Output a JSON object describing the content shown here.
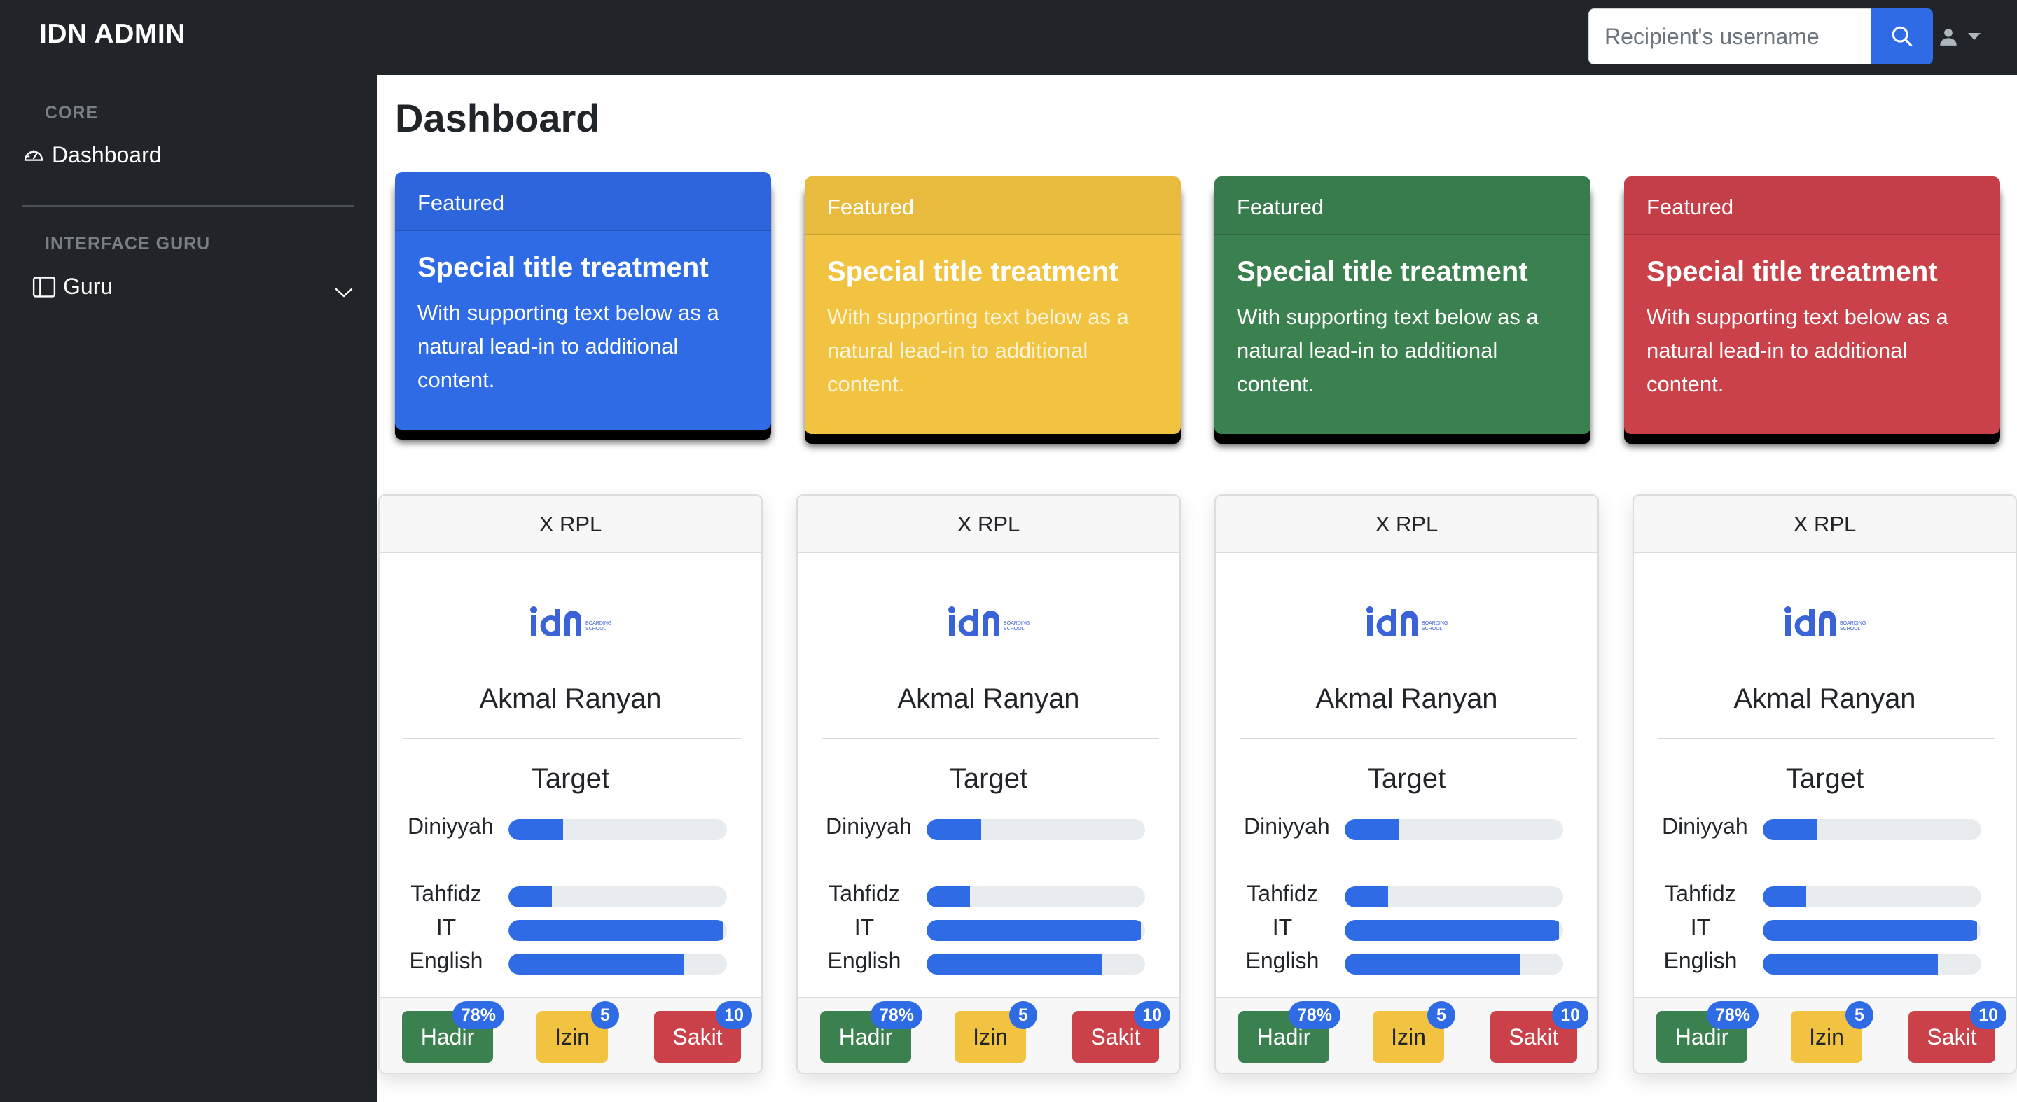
{
  "brand": "IDN ADMIN",
  "search": {
    "placeholder": "Recipient's username",
    "icon": "search-icon"
  },
  "user_menu": {
    "icon": "user-icon"
  },
  "sidebar": {
    "sections": [
      {
        "heading": "CORE",
        "items": [
          {
            "label": "Dashboard",
            "icon": "speedometer-icon"
          }
        ]
      },
      {
        "heading": "INTERFACE GURU",
        "items": [
          {
            "label": "Guru",
            "icon": "columns-icon",
            "expandable": true
          }
        ]
      }
    ]
  },
  "page": {
    "title": "Dashboard"
  },
  "featured_cards": [
    {
      "header": "Featured",
      "title": "Special title treatment",
      "text": "With supporting text below as a natural lead-in to additional content.",
      "color": "#2f6be5"
    },
    {
      "header": "Featured",
      "title": "Special title treatment",
      "text": "With supporting text below as a natural lead-in to additional content.",
      "color": "#f2c341"
    },
    {
      "header": "Featured",
      "title": "Special title treatment",
      "text": "With supporting text below as a natural lead-in to additional content.",
      "color": "#3b8150"
    },
    {
      "header": "Featured",
      "title": "Special title treatment",
      "text": "With supporting text below as a natural lead-in to additional content.",
      "color": "#cb4149"
    }
  ],
  "student_cards": [
    {
      "class": "X RPL",
      "name": "Akmal Ranyan",
      "target_label": "Target",
      "progress": [
        {
          "label": "Diniyyah",
          "value": 25
        },
        {
          "label": "Tahfidz",
          "value": 20
        },
        {
          "label": "IT",
          "value": 98
        },
        {
          "label": "English",
          "value": 80
        }
      ],
      "status": {
        "hadir": "Hadir",
        "hadir_badge": "78%",
        "izin": "Izin",
        "izin_badge": "5",
        "sakit": "Sakit",
        "sakit_badge": "10"
      }
    },
    {
      "class": "X RPL",
      "name": "Akmal Ranyan",
      "target_label": "Target",
      "progress": [
        {
          "label": "Diniyyah",
          "value": 25
        },
        {
          "label": "Tahfidz",
          "value": 20
        },
        {
          "label": "IT",
          "value": 98
        },
        {
          "label": "English",
          "value": 80
        }
      ],
      "status": {
        "hadir": "Hadir",
        "hadir_badge": "78%",
        "izin": "Izin",
        "izin_badge": "5",
        "sakit": "Sakit",
        "sakit_badge": "10"
      }
    },
    {
      "class": "X RPL",
      "name": "Akmal Ranyan",
      "target_label": "Target",
      "progress": [
        {
          "label": "Diniyyah",
          "value": 25
        },
        {
          "label": "Tahfidz",
          "value": 20
        },
        {
          "label": "IT",
          "value": 98
        },
        {
          "label": "English",
          "value": 80
        }
      ],
      "status": {
        "hadir": "Hadir",
        "hadir_badge": "78%",
        "izin": "Izin",
        "izin_badge": "5",
        "sakit": "Sakit",
        "sakit_badge": "10"
      }
    },
    {
      "class": "X RPL",
      "name": "Akmal Ranyan",
      "target_label": "Target",
      "progress": [
        {
          "label": "Diniyyah",
          "value": 25
        },
        {
          "label": "Tahfidz",
          "value": 20
        },
        {
          "label": "IT",
          "value": 98
        },
        {
          "label": "English",
          "value": 80
        }
      ],
      "status": {
        "hadir": "Hadir",
        "hadir_badge": "78%",
        "izin": "Izin",
        "izin_badge": "5",
        "sakit": "Sakit",
        "sakit_badge": "10"
      }
    }
  ],
  "logo_text": "idn BOARDING SCHOOL"
}
